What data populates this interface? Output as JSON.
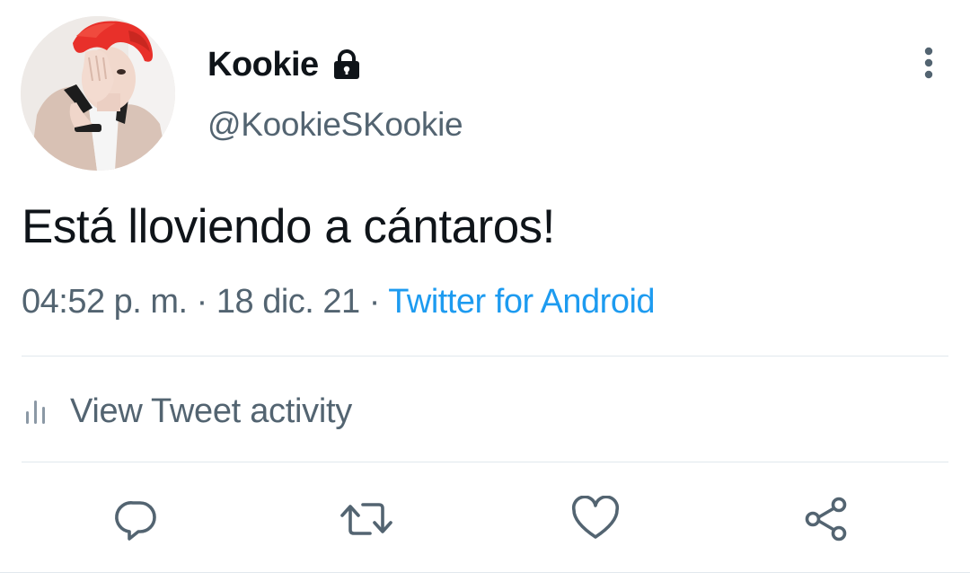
{
  "author": {
    "display_name": "Kookie",
    "handle": "@KookieSKookie",
    "protected_icon": "lock-icon",
    "avatar": "profile-photo"
  },
  "tweet": {
    "text": "Está lloviendo a cántaros!",
    "time": "04:52 p. m.",
    "separator": " · ",
    "date": "18 dic. 21",
    "source": "Twitter for Android"
  },
  "activity": {
    "icon": "bar-chart-icon",
    "label": "View Tweet activity"
  },
  "actions": [
    {
      "name": "reply",
      "icon": "reply-icon"
    },
    {
      "name": "retweet",
      "icon": "retweet-icon"
    },
    {
      "name": "like",
      "icon": "heart-icon"
    },
    {
      "name": "share",
      "icon": "share-icon"
    }
  ],
  "colors": {
    "text_primary": "#0f1419",
    "text_secondary": "#536471",
    "link": "#1d9bf0",
    "divider": "#e1e8ed"
  }
}
